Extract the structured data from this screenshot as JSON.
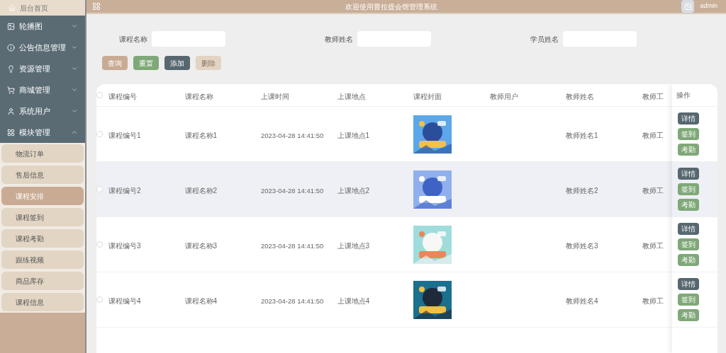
{
  "sidebar": {
    "home": "后台首页",
    "items": [
      {
        "label": "轮播图",
        "expanded": false
      },
      {
        "label": "公告信息管理",
        "expanded": false
      },
      {
        "label": "资源管理",
        "expanded": false
      },
      {
        "label": "商城管理",
        "expanded": false
      },
      {
        "label": "系统用户",
        "expanded": false
      },
      {
        "label": "模块管理",
        "expanded": true,
        "children": [
          {
            "label": "物流订单",
            "selected": false
          },
          {
            "label": "售后信息",
            "selected": false
          },
          {
            "label": "课程安排",
            "selected": true
          },
          {
            "label": "课程签到",
            "selected": false
          },
          {
            "label": "课程考勤",
            "selected": false
          },
          {
            "label": "跟练视频",
            "selected": false
          },
          {
            "label": "商品库存",
            "selected": false
          },
          {
            "label": "课程信息",
            "selected": false
          }
        ]
      }
    ]
  },
  "header": {
    "title": "欢迎使用普拉提会馆管理系统",
    "user": "admin"
  },
  "search": {
    "fields": [
      {
        "label": "课程名称"
      },
      {
        "label": "教师姓名"
      },
      {
        "label": "学员姓名"
      }
    ],
    "buttons": [
      {
        "label": "查询",
        "kind": "query",
        "disabled": false
      },
      {
        "label": "重置",
        "kind": "reset",
        "disabled": false
      },
      {
        "label": "添加",
        "kind": "add",
        "disabled": false
      },
      {
        "label": "删除",
        "kind": "delete",
        "disabled": true
      }
    ]
  },
  "table": {
    "all_checked": false,
    "columns": [
      "课程编号",
      "课程名称",
      "上课时间",
      "上课地点",
      "课程封面",
      "教师用户",
      "教师姓名",
      "教师工"
    ],
    "actions_header": "操作",
    "rows": [
      {
        "cells": [
          "课程编号1",
          "课程名称1",
          "2023-04-28 14:41:50",
          "上课地点1",
          null,
          null,
          "教师姓名1",
          "教师工"
        ],
        "checked": false,
        "hovered": false,
        "actions": [
          "详情",
          "签到",
          "考勤"
        ]
      },
      {
        "cells": [
          "课程编号2",
          "课程名称2",
          "2023-04-28 14:41:50",
          "上课地点2",
          null,
          null,
          "教师姓名2",
          "教师工"
        ],
        "checked": false,
        "hovered": true,
        "actions": [
          "详情",
          "签到",
          "考勤"
        ]
      },
      {
        "cells": [
          "课程编号3",
          "课程名称3",
          "2023-04-28 14:41:50",
          "上课地点3",
          null,
          null,
          "教师姓名3",
          "教师工"
        ],
        "checked": false,
        "hovered": false,
        "actions": [
          "详情",
          "签到",
          "考勤"
        ]
      },
      {
        "cells": [
          "课程编号4",
          "课程名称4",
          "2023-04-28 14:41:50",
          "上课地点4",
          null,
          null,
          "教师姓名4",
          "教师工"
        ],
        "checked": false,
        "hovered": false,
        "actions": [
          "详情",
          "签到",
          "考勤"
        ]
      }
    ]
  }
}
